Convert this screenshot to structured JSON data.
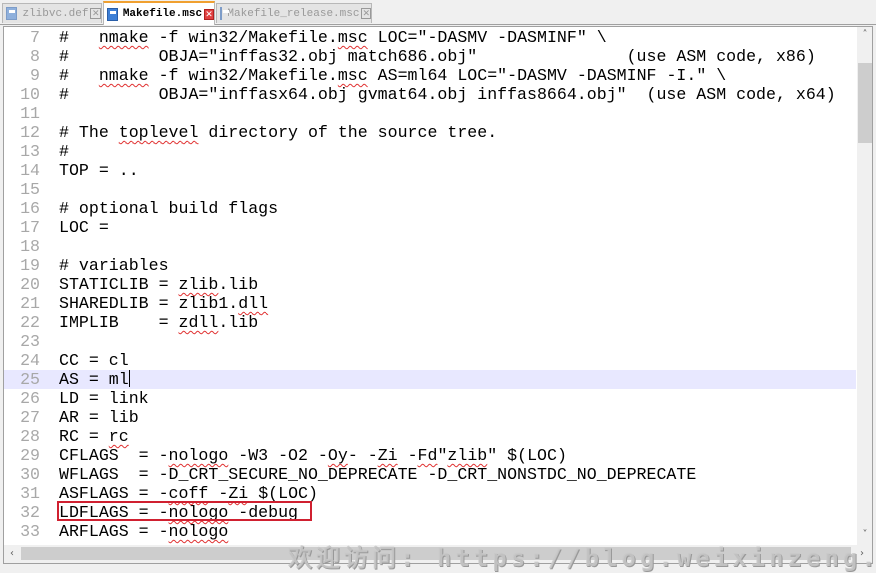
{
  "tabs": [
    {
      "label": "zlibvc.def",
      "active": false,
      "icon": "file-icon"
    },
    {
      "label": "Makefile.msc",
      "active": true,
      "icon": "file-icon"
    },
    {
      "label": "Makefile_release.msc",
      "active": false,
      "icon": "file-icon"
    }
  ],
  "close_glyph": "✕",
  "editor": {
    "current_line": 25,
    "highlighted_line": 32,
    "lines": [
      {
        "n": "7",
        "segs": [
          {
            "t": "#   "
          },
          {
            "t": "nmake",
            "sq": true
          },
          {
            "t": " -f win32/Makefile."
          },
          {
            "t": "msc",
            "sq": true
          },
          {
            "t": " LOC=\"-DASMV -DASMINF\" \\"
          }
        ]
      },
      {
        "n": "8",
        "segs": [
          {
            "t": "#         OBJA=\"inffas32.obj match686.obj\"               (use ASM code, x86)"
          }
        ]
      },
      {
        "n": "9",
        "segs": [
          {
            "t": "#   "
          },
          {
            "t": "nmake",
            "sq": true
          },
          {
            "t": " -f win32/Makefile."
          },
          {
            "t": "msc",
            "sq": true
          },
          {
            "t": " AS=ml64 LOC=\"-DASMV -DASMINF -I.\" \\"
          }
        ]
      },
      {
        "n": "10",
        "segs": [
          {
            "t": "#         OBJA=\"inffasx64.obj gvmat64.obj inffas8664.obj\"  (use ASM code, x64)"
          }
        ]
      },
      {
        "n": "11",
        "segs": [
          {
            "t": ""
          }
        ]
      },
      {
        "n": "12",
        "segs": [
          {
            "t": "# The "
          },
          {
            "t": "toplevel",
            "sq": true
          },
          {
            "t": " directory of the source tree."
          }
        ]
      },
      {
        "n": "13",
        "segs": [
          {
            "t": "#"
          }
        ]
      },
      {
        "n": "14",
        "segs": [
          {
            "t": "TOP = .."
          }
        ]
      },
      {
        "n": "15",
        "segs": [
          {
            "t": ""
          }
        ]
      },
      {
        "n": "16",
        "segs": [
          {
            "t": "# optional build flags"
          }
        ]
      },
      {
        "n": "17",
        "segs": [
          {
            "t": "LOC ="
          }
        ]
      },
      {
        "n": "18",
        "segs": [
          {
            "t": ""
          }
        ]
      },
      {
        "n": "19",
        "segs": [
          {
            "t": "# variables"
          }
        ]
      },
      {
        "n": "20",
        "segs": [
          {
            "t": "STATICLIB = "
          },
          {
            "t": "zlib",
            "sq": true
          },
          {
            "t": ".lib"
          }
        ]
      },
      {
        "n": "21",
        "segs": [
          {
            "t": "SHAREDLIB = zlib1."
          },
          {
            "t": "dll",
            "sq": true
          }
        ]
      },
      {
        "n": "22",
        "segs": [
          {
            "t": "IMPLIB    = "
          },
          {
            "t": "zdll",
            "sq": true
          },
          {
            "t": ".lib"
          }
        ]
      },
      {
        "n": "23",
        "segs": [
          {
            "t": ""
          }
        ]
      },
      {
        "n": "24",
        "segs": [
          {
            "t": "CC = cl"
          }
        ]
      },
      {
        "n": "25",
        "segs": [
          {
            "t": "AS = ml"
          }
        ]
      },
      {
        "n": "26",
        "segs": [
          {
            "t": "LD = link"
          }
        ]
      },
      {
        "n": "27",
        "segs": [
          {
            "t": "AR = lib"
          }
        ]
      },
      {
        "n": "28",
        "segs": [
          {
            "t": "RC = "
          },
          {
            "t": "rc",
            "sq": true
          }
        ]
      },
      {
        "n": "29",
        "segs": [
          {
            "t": "CFLAGS  = -"
          },
          {
            "t": "nologo",
            "sq": true
          },
          {
            "t": " -W3 -O2 -"
          },
          {
            "t": "Oy",
            "sq": true
          },
          {
            "t": "- -"
          },
          {
            "t": "Zi",
            "sq": true
          },
          {
            "t": " -"
          },
          {
            "t": "Fd",
            "sq": true
          },
          {
            "t": "\""
          },
          {
            "t": "zlib",
            "sq": true
          },
          {
            "t": "\" $(LOC)"
          }
        ]
      },
      {
        "n": "30",
        "segs": [
          {
            "t": "WFLAGS  = -D_CRT_SECURE_NO_DEPRECATE -D_CRT_NONSTDC_NO_DEPRECATE"
          }
        ]
      },
      {
        "n": "31",
        "segs": [
          {
            "t": "ASFLAGS = -"
          },
          {
            "t": "coff",
            "sq": true
          },
          {
            "t": " -"
          },
          {
            "t": "Zi",
            "sq": true
          },
          {
            "t": " $(LOC)"
          }
        ]
      },
      {
        "n": "32",
        "segs": [
          {
            "t": "LDFLAGS = -"
          },
          {
            "t": "nologo",
            "sq": true
          },
          {
            "t": " -debug"
          }
        ]
      },
      {
        "n": "33",
        "segs": [
          {
            "t": "ARFLAGS = -"
          },
          {
            "t": "nologo",
            "sq": true
          }
        ]
      }
    ]
  },
  "scrollbars": {
    "up": "˄",
    "down": "˅",
    "left": "‹",
    "right": "›"
  },
  "watermark": "欢迎访问: https://blog.weixinzeng.cn",
  "colors": {
    "current_line": "#e8e8ff",
    "highlight_box": "#d02030",
    "spellcheck": "#e03030",
    "active_tab_accent": "#f0a030"
  }
}
